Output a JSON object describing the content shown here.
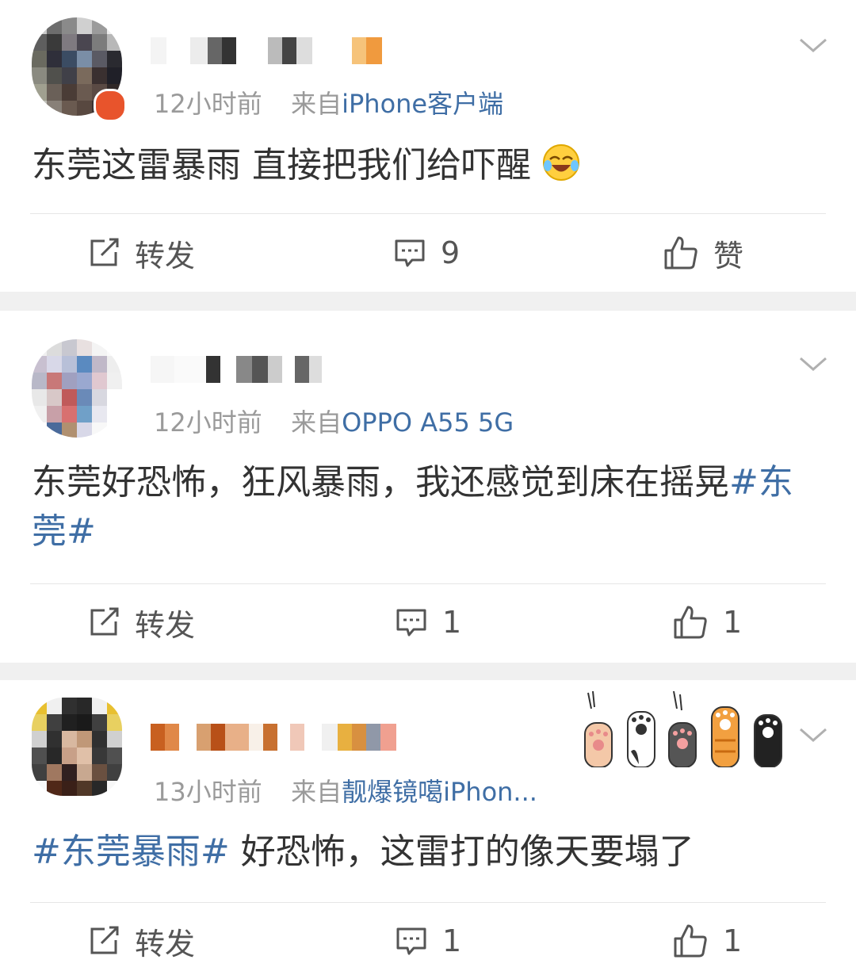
{
  "posts": [
    {
      "time": "12小时前",
      "from_prefix": "来自",
      "source": "iPhone客户端",
      "text": "东莞这雷暴雨 直接把我们给吓醒",
      "emoji": "laughing-crying-emoji",
      "actions": {
        "repost": "转发",
        "comment": "9",
        "like": "赞"
      }
    },
    {
      "time": "12小时前",
      "from_prefix": "来自",
      "source": "OPPO A55 5G",
      "text": "东莞好恐怖，狂风暴雨，我还感觉到床在摇晃",
      "topic": "#东莞#",
      "actions": {
        "repost": "转发",
        "comment": "1",
        "like": "1"
      }
    },
    {
      "time": "13小时前",
      "from_prefix": "来自",
      "source": "靓爆镜噶iPhon...",
      "topic": "#东莞暴雨#",
      "text": " 好恐怖，这雷打的像天要塌了",
      "actions": {
        "repost": "转发",
        "comment": "1",
        "like": "1"
      }
    }
  ],
  "icons": {
    "repost": "repost-icon",
    "comment": "comment-icon",
    "like": "thumbs-up-icon",
    "menu": "chevron-down-icon",
    "decoration": "cat-paws-decoration"
  },
  "colors": {
    "link": "#3f6ea5",
    "meta": "#9a9a9a",
    "separator": "#f0f0f0",
    "text": "#333333"
  }
}
